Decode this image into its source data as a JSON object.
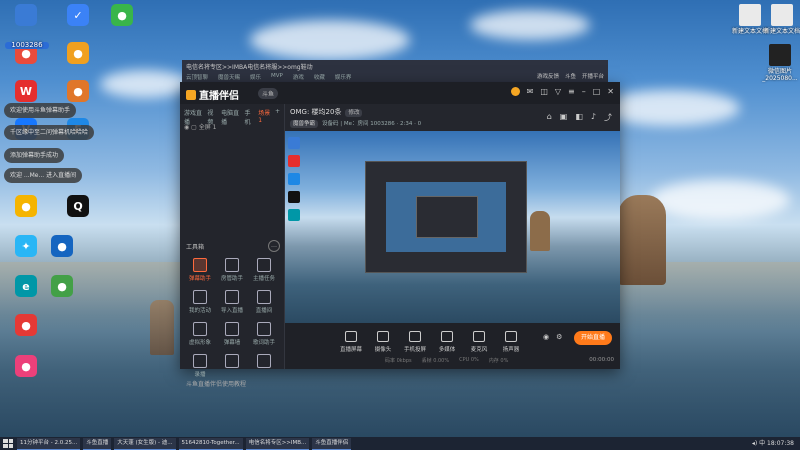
{
  "desktop": {
    "left_icons": [
      {
        "label": "",
        "color": "#3a7bd5",
        "glyph": ""
      },
      {
        "label": "",
        "color": "#3b82f6",
        "glyph": "✓"
      },
      {
        "label": "",
        "color": "#39b54a",
        "glyph": "●"
      },
      {
        "label": "",
        "color": "#e94b3c",
        "glyph": "●"
      },
      {
        "label": "",
        "color": "#f0a020",
        "glyph": "●"
      },
      {
        "label": "",
        "color": "#e52e2e",
        "glyph": "W"
      },
      {
        "label": "",
        "color": "#e0762a",
        "glyph": "●"
      },
      {
        "label": "",
        "color": "#1677ff",
        "glyph": "V"
      },
      {
        "label": "",
        "color": "#1e88e5",
        "glyph": "F"
      },
      {
        "label": "",
        "color": "#f5b400",
        "glyph": "●"
      },
      {
        "label": "",
        "color": "#111",
        "glyph": "Q"
      },
      {
        "label": "",
        "color": "#29b6f6",
        "glyph": "✦"
      },
      {
        "label": "",
        "color": "#1565c0",
        "glyph": "●"
      },
      {
        "label": "",
        "color": "#0097a7",
        "glyph": "e"
      },
      {
        "label": "",
        "color": "#43a047",
        "glyph": "●"
      },
      {
        "label": "",
        "color": "#e53935",
        "glyph": "●"
      },
      {
        "label": "",
        "color": "#ec407a",
        "glyph": "●"
      }
    ],
    "right_icons": [
      {
        "label": "新建文本文档",
        "color": "#eaeaea",
        "glyph": ""
      },
      {
        "label": "新建文本文档",
        "color": "#eaeaea",
        "glyph": ""
      },
      {
        "label": "微信图片_2025080...",
        "color": "#222",
        "glyph": ""
      }
    ],
    "toasts": [
      "欢迎使用斗鱼弹幕助手",
      "千区缘中至二问弹幕机哈哈哈",
      "添加弹幕助手成功",
      "欢迎 ...Me... 进入直播间"
    ],
    "overlay_id": "1003286"
  },
  "back_window": {
    "title": "电信名将专区>>IMBA电信名将服>>omg鞋动",
    "tabs": [
      "云顶智聊",
      "魔兽天赐",
      "娱乐",
      "MVP",
      "游戏",
      "收藏",
      "娱乐界"
    ],
    "right_tabs": [
      "游戏反馈",
      "斗鱼",
      "开播平台"
    ]
  },
  "app": {
    "name": "直播伴侣",
    "version_badge": "斗鱼",
    "left_tabs": [
      "游戏直播",
      "视频",
      "电脑直播",
      "手机",
      "场景1"
    ],
    "active_tab_index": 4,
    "scene_label": "全屏 1",
    "tools_heading": "工具箱",
    "tools": [
      {
        "label": "弹幕助手",
        "hot": true
      },
      {
        "label": "房管助手",
        "hot": false
      },
      {
        "label": "主播任务",
        "hot": false
      },
      {
        "label": "我的活动",
        "hot": false
      },
      {
        "label": "导入直播",
        "hot": false
      },
      {
        "label": "直播间",
        "hot": false
      },
      {
        "label": "虚拟形象",
        "hot": false
      },
      {
        "label": "弹幕墙",
        "hot": false
      },
      {
        "label": "歌词助手",
        "hot": false
      },
      {
        "label": "录播",
        "hot": false
      },
      {
        "label": "",
        "hot": false
      },
      {
        "label": "",
        "hot": false
      }
    ],
    "tip": "斗鱼直播伴侣使用教程",
    "room_title": "OMG: 楼均20条",
    "room_tag": "修改",
    "meta_tag": "魔兽争霸",
    "meta_text": "设备码 | Me：房间 1003286 · 2:34 · 0",
    "bottom_tools": [
      "直播屏幕",
      "摄像头",
      "手机投屏",
      "多媒体",
      "麦克风",
      "扬声器"
    ],
    "go_live": "开始直播",
    "stats": [
      "码率 0kbps",
      "丢帧 0.00%",
      "CPU 0%",
      "内存 0%"
    ],
    "elapsed": "00:00:00"
  },
  "taskbar": {
    "tasks": [
      "11分钟平台 - 2.0.25...",
      "斗鱼直播",
      "大天蓬 (女生版) - 迪...",
      "51642810-Together...",
      "电信名将专区>>IMB...",
      "斗鱼直播伴侣"
    ],
    "time": "18:07:38"
  }
}
